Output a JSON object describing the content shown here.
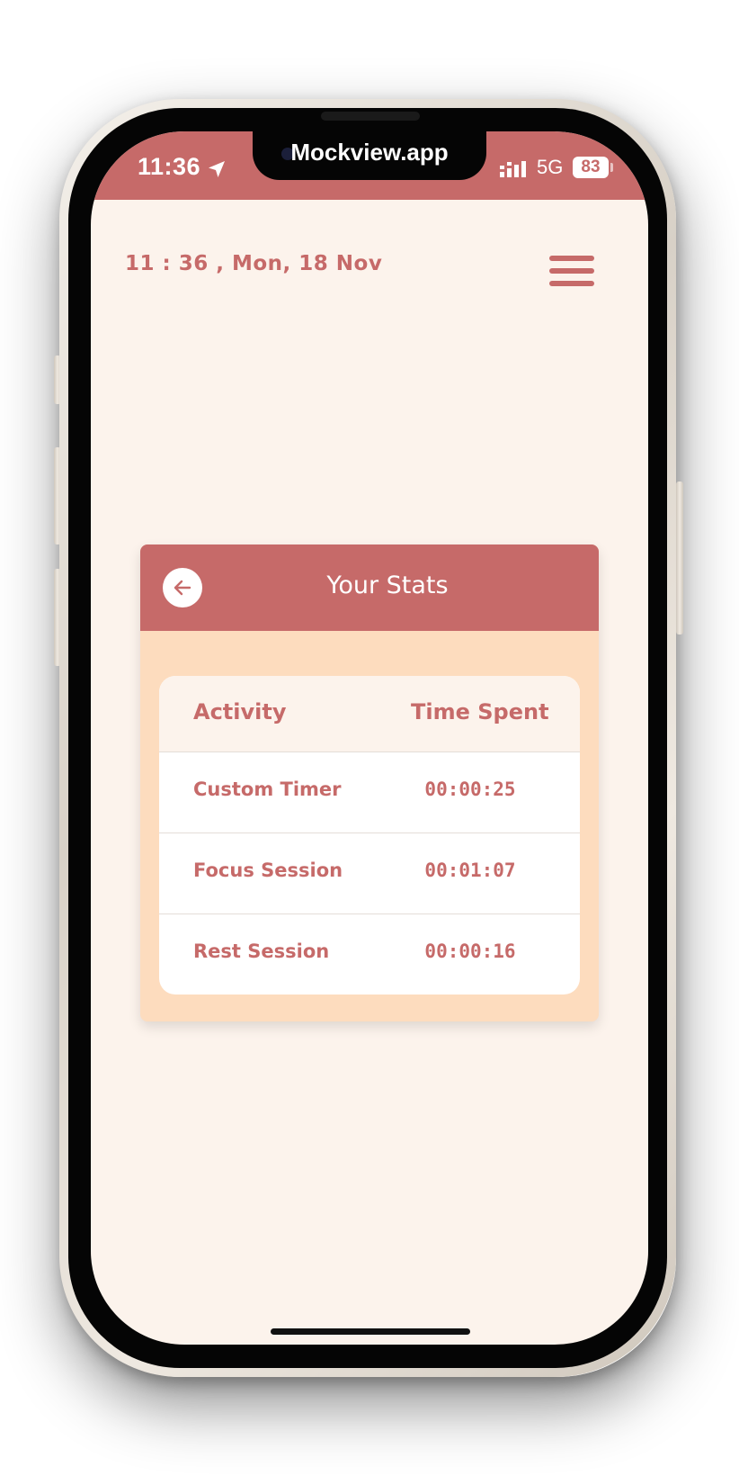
{
  "status_bar": {
    "time": "11:36",
    "location_icon": "location-arrow-icon",
    "notch_title": "Mockview.app",
    "signal_icon": "cellular-signal-icon",
    "network": "5G",
    "battery": "83"
  },
  "header": {
    "datetime": "11 : 36 ,  Mon, 18 Nov",
    "menu_icon": "hamburger-menu-icon"
  },
  "stats_card": {
    "title": "Your Stats",
    "back_icon": "arrow-left-icon",
    "columns": [
      "Activity",
      "Time Spent"
    ],
    "rows": [
      {
        "activity": "Custom Timer",
        "time": "00:00:25"
      },
      {
        "activity": "Focus Session",
        "time": "00:01:07"
      },
      {
        "activity": "Rest Session",
        "time": "00:00:16"
      }
    ]
  },
  "colors": {
    "accent": "#c66a69",
    "background": "#fcf3ec",
    "card": "#fddcbe",
    "table": "#ffffff"
  }
}
